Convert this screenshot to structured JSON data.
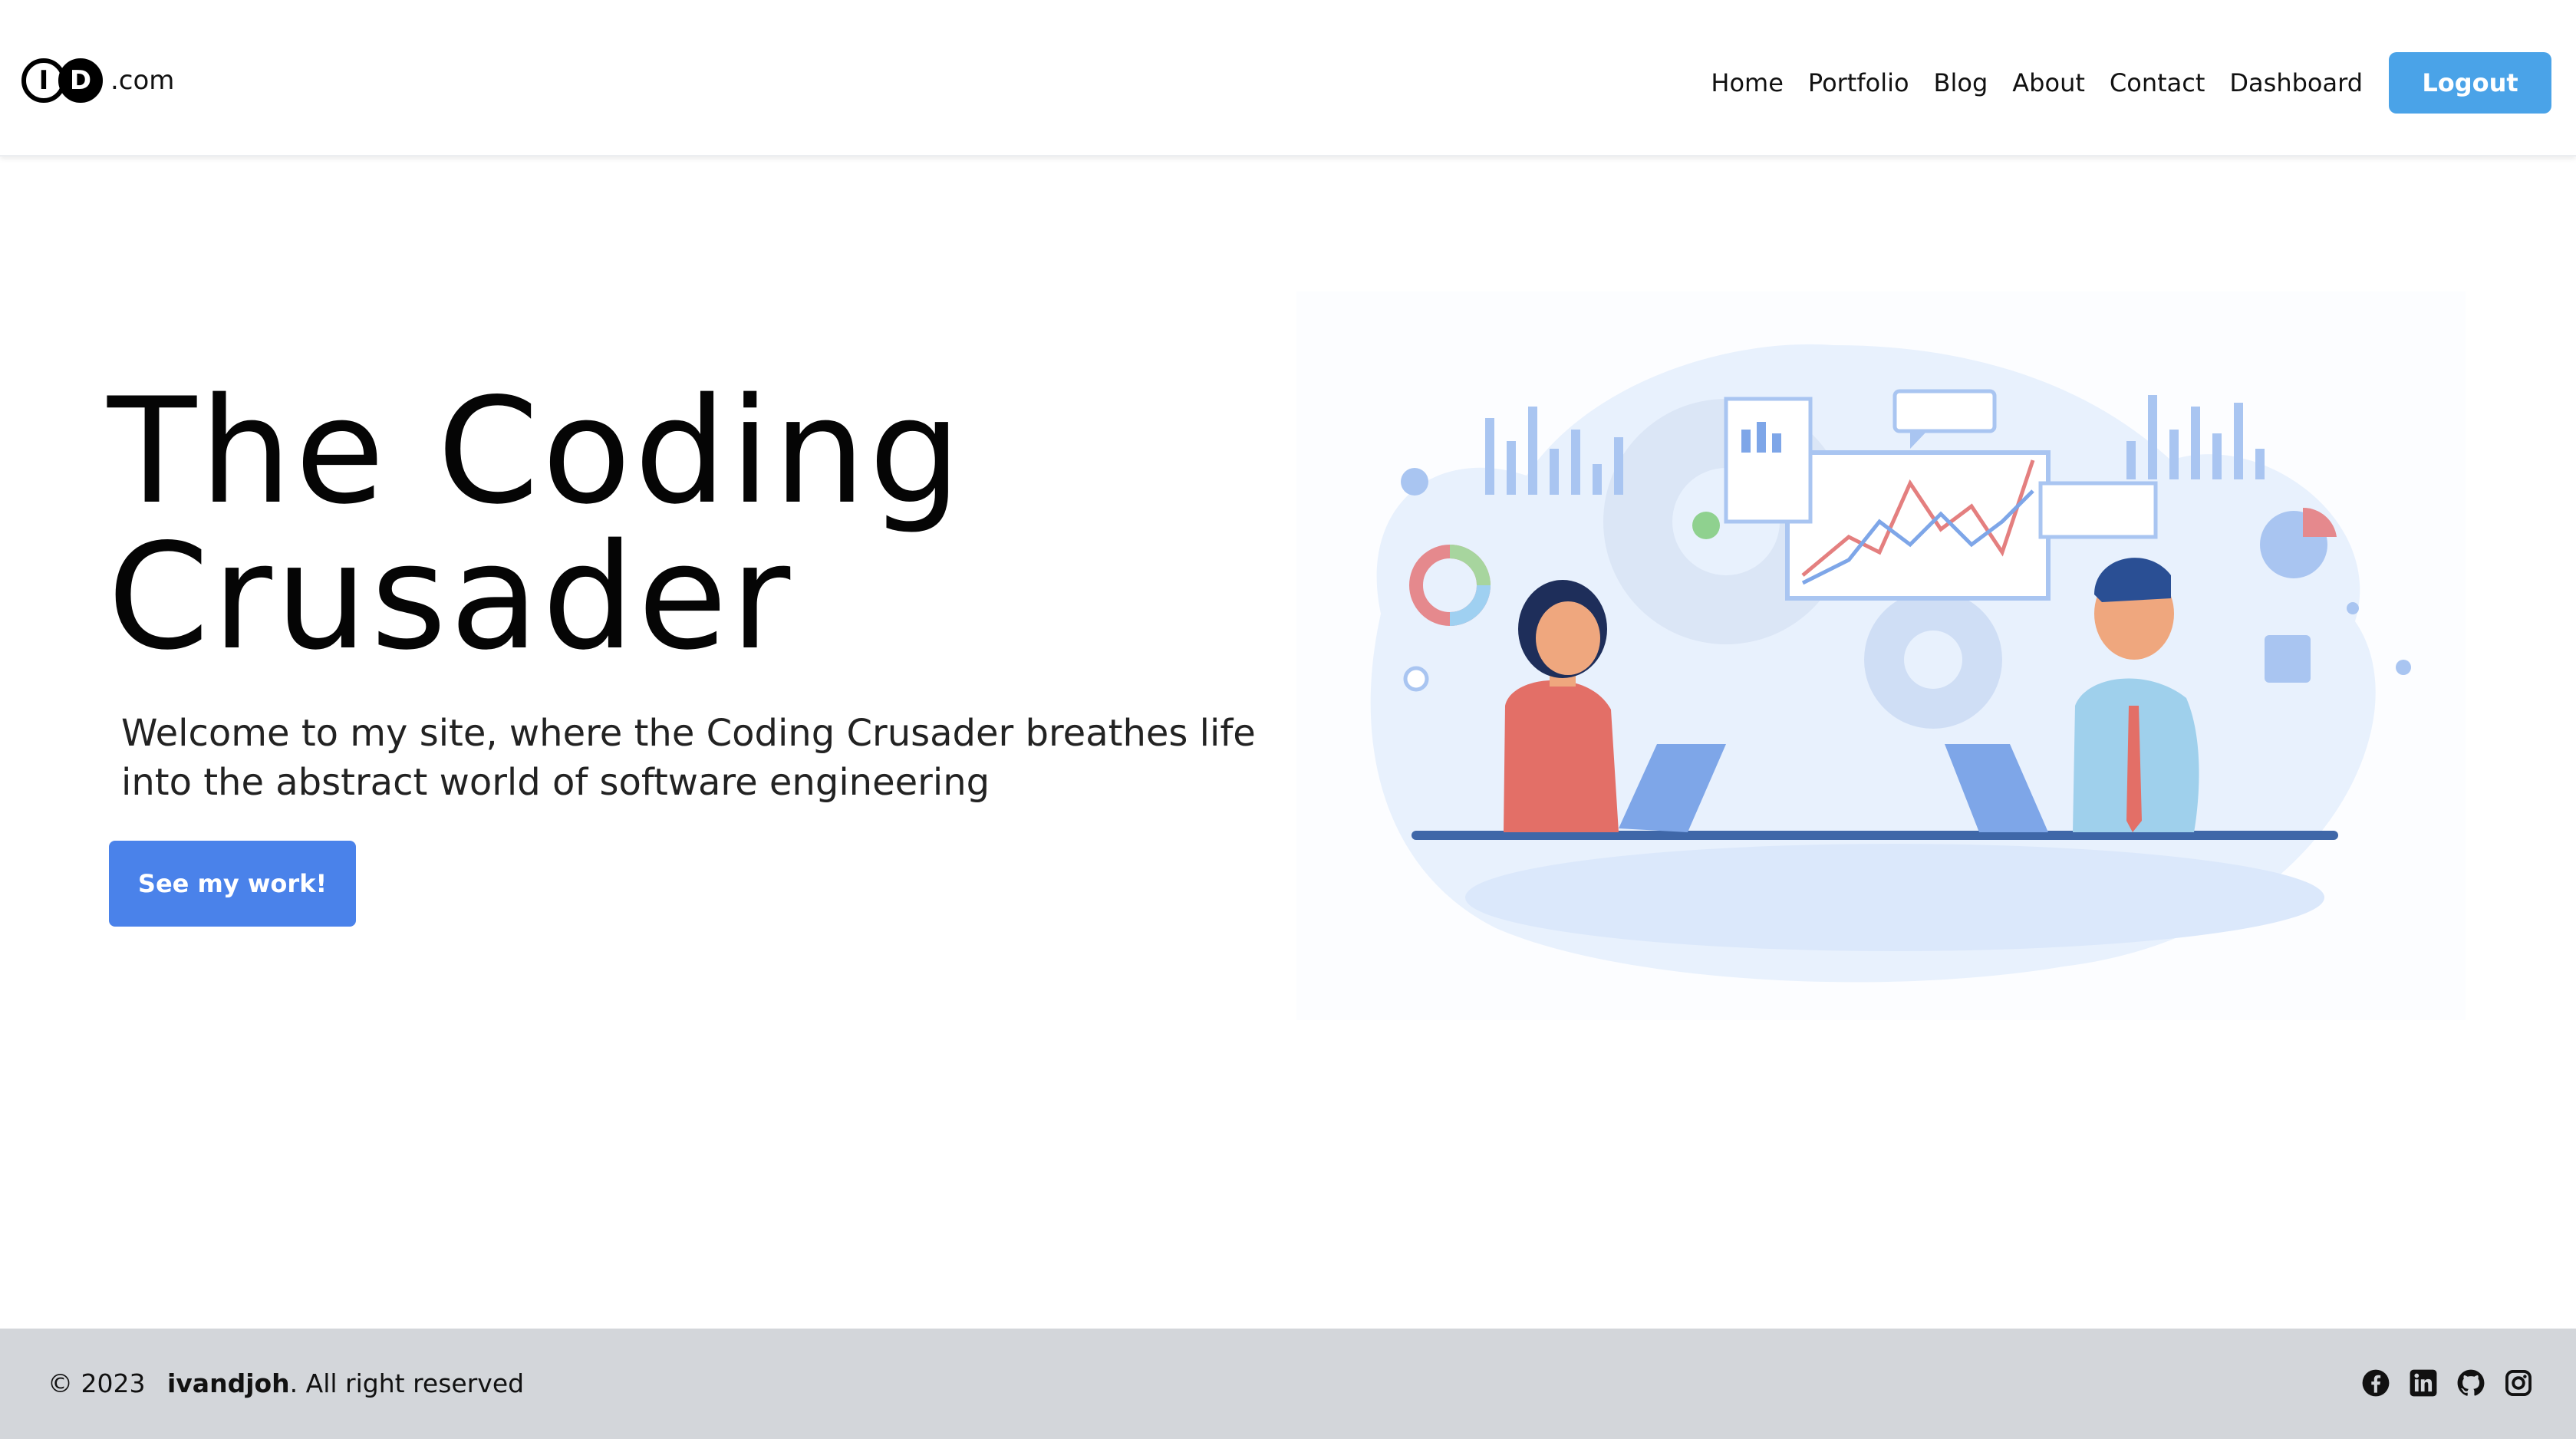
{
  "header": {
    "logo": {
      "left_letter": "I",
      "right_letter": "D",
      "suffix": ".com"
    },
    "nav": [
      {
        "label": "Home"
      },
      {
        "label": "Portfolio"
      },
      {
        "label": "Blog"
      },
      {
        "label": "About"
      },
      {
        "label": "Contact"
      },
      {
        "label": "Dashboard"
      }
    ],
    "logout_label": "Logout"
  },
  "hero": {
    "title_line1": "The Coding",
    "title_line2": "Crusader",
    "subtitle": "Welcome to my site, where the Coding Crusader breathes life into the abstract world of software engineering",
    "cta_label": "See my work!"
  },
  "footer": {
    "copyright": "© 2023",
    "owner": "ivandjoh",
    "rights": ". All right reserved",
    "socials": [
      "facebook-icon",
      "linkedin-icon",
      "github-icon",
      "instagram-icon"
    ]
  },
  "colors": {
    "logout_bg": "#4aa3e8",
    "cta_bg": "#4a82ea",
    "footer_bg": "#d3d6da"
  }
}
